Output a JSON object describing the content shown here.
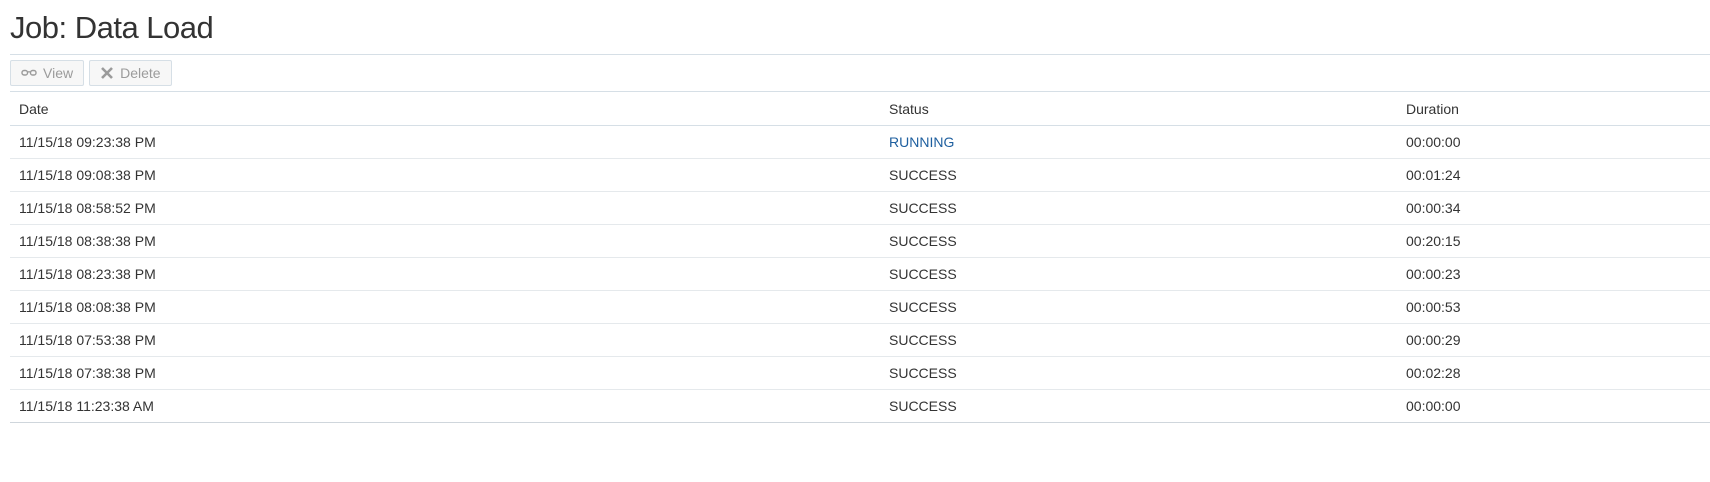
{
  "page": {
    "title": "Job: Data Load"
  },
  "toolbar": {
    "view_label": "View",
    "view_icon": "glasses-icon",
    "delete_label": "Delete",
    "delete_icon": "x-icon"
  },
  "table": {
    "columns": [
      "Date",
      "Status",
      "Duration"
    ],
    "rows": [
      {
        "date": "11/15/18 09:23:38 PM",
        "status": "RUNNING",
        "duration": "00:00:00"
      },
      {
        "date": "11/15/18 09:08:38 PM",
        "status": "SUCCESS",
        "duration": "00:01:24"
      },
      {
        "date": "11/15/18 08:58:52 PM",
        "status": "SUCCESS",
        "duration": "00:00:34"
      },
      {
        "date": "11/15/18 08:38:38 PM",
        "status": "SUCCESS",
        "duration": "00:20:15"
      },
      {
        "date": "11/15/18 08:23:38 PM",
        "status": "SUCCESS",
        "duration": "00:00:23"
      },
      {
        "date": "11/15/18 08:08:38 PM",
        "status": "SUCCESS",
        "duration": "00:00:53"
      },
      {
        "date": "11/15/18 07:53:38 PM",
        "status": "SUCCESS",
        "duration": "00:00:29"
      },
      {
        "date": "11/15/18 07:38:38 PM",
        "status": "SUCCESS",
        "duration": "00:02:28"
      },
      {
        "date": "11/15/18 11:23:38 AM",
        "status": "SUCCESS",
        "duration": "00:00:00"
      }
    ]
  },
  "colors": {
    "running": "#1e5f9f",
    "text": "#333333",
    "disabled_button_text": "#9b9b9b"
  }
}
